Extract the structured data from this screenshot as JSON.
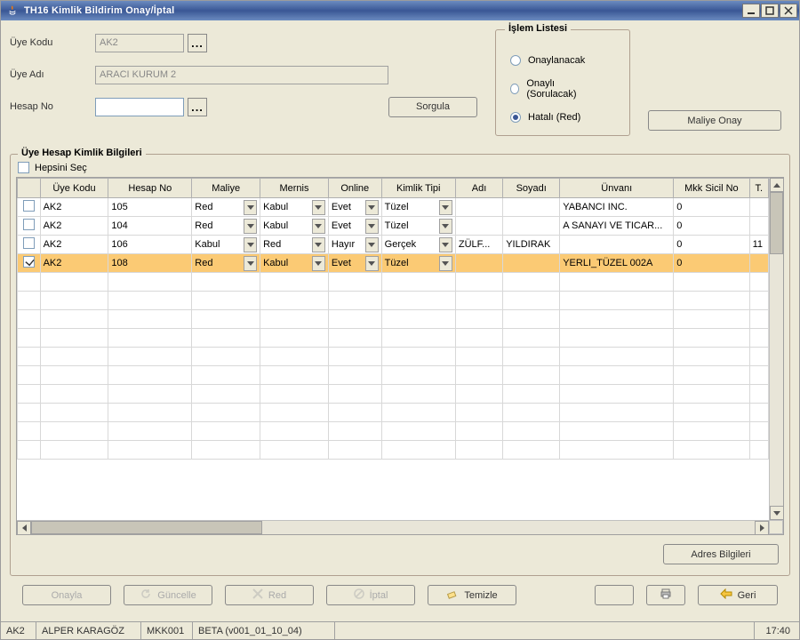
{
  "window": {
    "title": "TH16 Kimlik Bildirim Onay/İptal"
  },
  "form": {
    "uye_kodu_label": "Üye Kodu",
    "uye_kodu_value": "AK2",
    "uye_adi_label": "Üye Adı",
    "uye_adi_value": "ARACI KURUM 2",
    "hesap_no_label": "Hesap No",
    "hesap_no_value": "",
    "sorgula_label": "Sorgula"
  },
  "islem_listesi": {
    "legend": "İşlem Listesi",
    "options": [
      {
        "label": "Onaylanacak",
        "selected": false
      },
      {
        "label": "Onaylı (Sorulacak)",
        "selected": false
      },
      {
        "label": "Hatalı (Red)",
        "selected": true
      }
    ],
    "maliye_onay_label": "Maliye Onay"
  },
  "table": {
    "legend": "Üye Hesap Kimlik Bilgileri",
    "select_all_label": "Hepsini Seç",
    "columns": [
      "",
      "Üye Kodu",
      "Hesap No",
      "Maliye",
      "Mernis",
      "Online",
      "Kimlik Tipi",
      "Adı",
      "Soyadı",
      "Ünvanı",
      "Mkk Sicil No",
      "T."
    ],
    "rows": [
      {
        "checked": false,
        "uye_kodu": "AK2",
        "hesap_no": "105",
        "maliye": "Red",
        "mernis": "Kabul",
        "online": "Evet",
        "kimlik_tipi": "Tüzel",
        "adi": "",
        "soyadi": "",
        "unvani": "YABANCI INC.",
        "mkk_sicil_no": "0",
        "t": ""
      },
      {
        "checked": false,
        "uye_kodu": "AK2",
        "hesap_no": "104",
        "maliye": "Red",
        "mernis": "Kabul",
        "online": "Evet",
        "kimlik_tipi": "Tüzel",
        "adi": "",
        "soyadi": "",
        "unvani": "A SANAYI VE TICAR...",
        "mkk_sicil_no": "0",
        "t": ""
      },
      {
        "checked": false,
        "uye_kodu": "AK2",
        "hesap_no": "106",
        "maliye": "Kabul",
        "mernis": "Red",
        "online": "Hayır",
        "kimlik_tipi": "Gerçek",
        "adi": "ZÜLF...",
        "soyadi": "YILDIRAK",
        "unvani": "",
        "mkk_sicil_no": "0",
        "t": "11"
      },
      {
        "checked": true,
        "uye_kodu": "AK2",
        "hesap_no": "108",
        "maliye": "Red",
        "mernis": "Kabul",
        "online": "Evet",
        "kimlik_tipi": "Tüzel",
        "adi": "",
        "soyadi": "",
        "unvani": "YERLI_TÜZEL 002A",
        "mkk_sicil_no": "0",
        "t": ""
      }
    ],
    "selected_index": 3,
    "adres_bilgileri_label": "Adres Bilgileri",
    "empty_row_count": 10
  },
  "buttons": {
    "onayla": "Onayla",
    "guncelle": "Güncelle",
    "red": "Red",
    "iptal": "İptal",
    "temizle": "Temizle",
    "geri": "Geri"
  },
  "status": {
    "cells": [
      "AK2",
      "ALPER KARAGÖZ",
      "MKK001",
      "BETA (v001_01_10_04)"
    ],
    "time": "17:40"
  }
}
